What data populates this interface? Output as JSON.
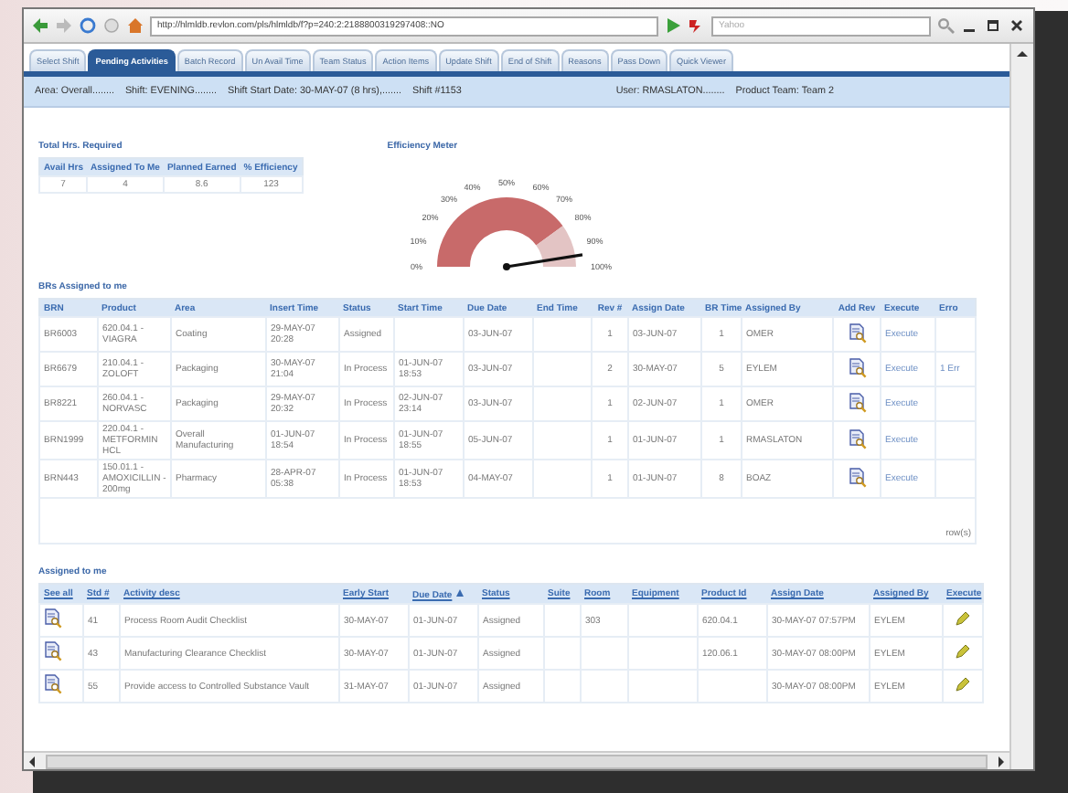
{
  "browser": {
    "address": "http://hlmldb.revlon.com/pls/hlmldb/f?p=240:2:2188800319297408::NO",
    "search": {
      "placeholder": "Yahoo"
    }
  },
  "tabs": [
    {
      "label": "Select Shift",
      "selected": false
    },
    {
      "label": "Pending Activities",
      "selected": true
    },
    {
      "label": "Batch Record",
      "selected": false
    },
    {
      "label": "Un Avail Time",
      "selected": false
    },
    {
      "label": "Team Status",
      "selected": false
    },
    {
      "label": "Action Items",
      "selected": false
    },
    {
      "label": "Update Shift",
      "selected": false
    },
    {
      "label": "End of Shift",
      "selected": false
    },
    {
      "label": "Reasons",
      "selected": false
    },
    {
      "label": "Pass Down",
      "selected": false
    },
    {
      "label": "Quick Viewer",
      "selected": false
    }
  ],
  "info_bar": {
    "left": [
      "Area: Overall........",
      "Shift: EVENING........",
      "Shift Start Date: 30-MAY-07 (8 hrs),.......",
      "Shift #1153"
    ],
    "right": [
      "User: RMASLATON........",
      "Product Team: Team 2"
    ]
  },
  "hours": {
    "title": "Total Hrs. Required",
    "columns": [
      "Avail Hrs",
      "Assigned To Me",
      "Planned Earned",
      "% Efficiency"
    ],
    "row": [
      "7",
      "4",
      "8.6",
      "123"
    ]
  },
  "meter": {
    "title": "Efficiency Meter",
    "ticks": [
      "0%",
      "10%",
      "20%",
      "30%",
      "40%",
      "50%",
      "60%",
      "70%",
      "80%",
      "90%",
      "100%"
    ]
  },
  "brs": {
    "title": "BRs Assigned to me",
    "columns": [
      "BRN",
      "Product",
      "Area",
      "Insert Time",
      "Status",
      "Start Time",
      "Due Date",
      "End Time",
      "Rev #",
      "Assign Date",
      "BR Time",
      "Assigned By",
      "Add Rev",
      "Execute",
      "Erro"
    ],
    "rows": [
      {
        "brn": "BR6003",
        "product": "620.04.1 - VIAGRA",
        "area": "Coating",
        "insert_time": "29-MAY-07 20:28",
        "status": "Assigned",
        "due_date": "03-JUN-07",
        "rev": "1",
        "assign_date": "03-JUN-07",
        "br_time": "1",
        "assigned_by": "OMER",
        "execute": "Execute"
      },
      {
        "brn": "BR6679",
        "product": "210.04.1 - ZOLOFT",
        "area": "Packaging",
        "insert_time": "30-MAY-07 21:04",
        "status": "In Process",
        "start_time": "01-JUN-07 18:53",
        "due_date": "03-JUN-07",
        "rev": "2",
        "assign_date": "30-MAY-07",
        "br_time": "5",
        "assigned_by": "EYLEM",
        "execute": "Execute",
        "error": "1 Err"
      },
      {
        "brn": "BR8221",
        "product": "260.04.1 - NORVASC",
        "area": "Packaging",
        "insert_time": "29-MAY-07 20:32",
        "status": "In Process",
        "start_time": "02-JUN-07 23:14",
        "due_date": "03-JUN-07",
        "rev": "1",
        "assign_date": "02-JUN-07",
        "br_time": "1",
        "assigned_by": "OMER",
        "execute": "Execute"
      },
      {
        "brn": "BRN1999",
        "product": "220.04.1 - METFORMIN HCL",
        "area": "Overall Manufacturing",
        "insert_time": "01-JUN-07 18:54",
        "status": "In Process",
        "start_time": "01-JUN-07 18:55",
        "due_date": "05-JUN-07",
        "rev": "1",
        "assign_date": "01-JUN-07",
        "br_time": "1",
        "assigned_by": "RMASLATON",
        "execute": "Execute"
      },
      {
        "brn": "BRN443",
        "product": "150.01.1 - AMOXICILLIN - 200mg",
        "area": "Pharmacy",
        "insert_time": "28-APR-07 05:38",
        "status": "In Process",
        "start_time": "01-JUN-07 18:53",
        "due_date": "04-MAY-07",
        "rev": "1",
        "assign_date": "01-JUN-07",
        "br_time": "8",
        "assigned_by": "BOAZ",
        "execute": "Execute"
      }
    ],
    "footer": "row(s)"
  },
  "assigned": {
    "title": "Assigned to me",
    "columns": [
      {
        "label": "See all",
        "sorted": false
      },
      {
        "label": "Std #",
        "sorted": false
      },
      {
        "label": "Activity desc",
        "sorted": false
      },
      {
        "label": "Early Start",
        "sorted": false
      },
      {
        "label": "Due Date",
        "sorted": true
      },
      {
        "label": "Status",
        "sorted": false
      },
      {
        "label": "Suite",
        "sorted": false
      },
      {
        "label": "Room",
        "sorted": false
      },
      {
        "label": "Equipment",
        "sorted": false
      },
      {
        "label": "Product Id",
        "sorted": false
      },
      {
        "label": "Assign Date",
        "sorted": false
      },
      {
        "label": "Assigned By",
        "sorted": false
      },
      {
        "label": "Execute",
        "sorted": false
      }
    ],
    "rows": [
      {
        "std": "41",
        "activity": "Process Room Audit Checklist",
        "early_start": "30-MAY-07",
        "due_date": "01-JUN-07",
        "status": "Assigned",
        "room": "303",
        "product_id": "620.04.1",
        "assign_date": "30-MAY-07 07:57PM",
        "assigned_by": "EYLEM"
      },
      {
        "std": "43",
        "activity": "Manufacturing Clearance Checklist",
        "early_start": "30-MAY-07",
        "due_date": "01-JUN-07",
        "status": "Assigned",
        "product_id": "120.06.1",
        "assign_date": "30-MAY-07 08:00PM",
        "assigned_by": "EYLEM"
      },
      {
        "std": "55",
        "activity": "Provide access to Controlled Substance Vault",
        "early_start": "31-MAY-07",
        "due_date": "01-JUN-07",
        "status": "Assigned",
        "assign_date": "30-MAY-07 08:00PM",
        "assigned_by": "EYLEM"
      }
    ]
  }
}
